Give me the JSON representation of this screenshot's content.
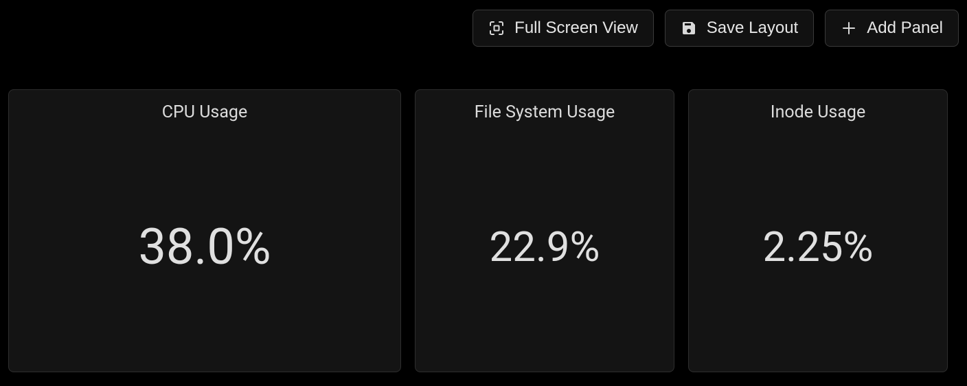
{
  "toolbar": {
    "fullscreen_label": "Full Screen View",
    "save_label": "Save Layout",
    "add_label": "Add Panel"
  },
  "panels": [
    {
      "title": "CPU Usage",
      "value": "38.0%"
    },
    {
      "title": "File System Usage",
      "value": "22.9%"
    },
    {
      "title": "Inode Usage",
      "value": "2.25%"
    }
  ]
}
